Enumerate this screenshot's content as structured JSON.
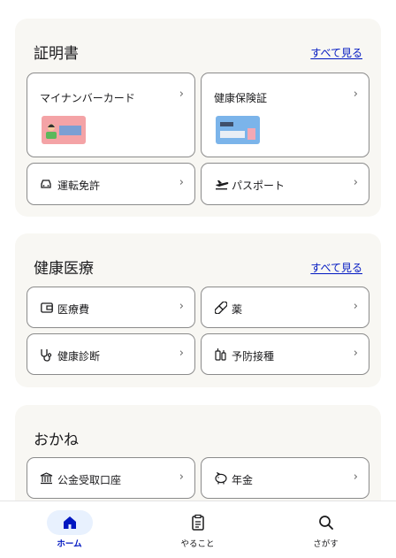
{
  "sections": [
    {
      "title": "証明書",
      "see_all": "すべて見る",
      "cards": [
        {
          "label": "マイナンバーカード",
          "icon": "mynumber-card-image"
        },
        {
          "label": "健康保険証",
          "icon": "insurance-card-image"
        },
        {
          "label": "運転免許",
          "icon": "car-icon"
        },
        {
          "label": "パスポート",
          "icon": "airplane-icon"
        }
      ]
    },
    {
      "title": "健康医療",
      "see_all": "すべて見る",
      "cards": [
        {
          "label": "医療費",
          "icon": "wallet-icon"
        },
        {
          "label": "薬",
          "icon": "pill-icon"
        },
        {
          "label": "健康診断",
          "icon": "stethoscope-icon"
        },
        {
          "label": "予防接種",
          "icon": "vaccine-icon"
        }
      ]
    },
    {
      "title": "おかね",
      "cards": [
        {
          "label": "公金受取口座",
          "icon": "bank-icon"
        },
        {
          "label": "年金",
          "icon": "piggy-bank-icon"
        }
      ]
    }
  ],
  "chevron": "›",
  "nav": [
    {
      "label": "ホーム",
      "icon": "home-icon",
      "active": true
    },
    {
      "label": "やること",
      "icon": "clipboard-icon",
      "active": false
    },
    {
      "label": "さがす",
      "icon": "search-icon",
      "active": false
    }
  ],
  "colors": {
    "accent": "#0017c1",
    "section_bg": "#f8f7f3",
    "card_border": "#8b8b8b",
    "nav_pill": "#e8f1fe"
  }
}
